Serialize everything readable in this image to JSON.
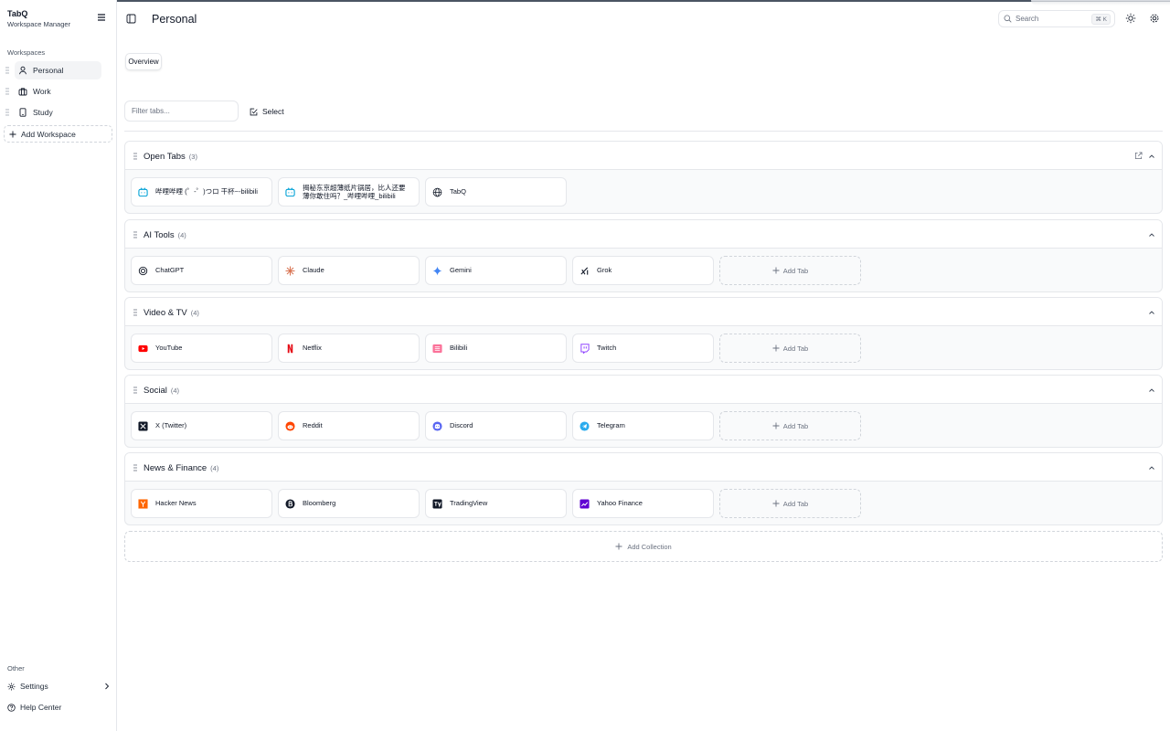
{
  "app": {
    "title": "TabQ",
    "subtitle": "Workspace Manager"
  },
  "sidebar": {
    "workspaces_label": "Workspaces",
    "workspaces": [
      {
        "label": "Personal",
        "icon": "user-icon",
        "active": true
      },
      {
        "label": "Work",
        "icon": "briefcase-icon",
        "active": false
      },
      {
        "label": "Study",
        "icon": "tablet-icon",
        "active": false
      }
    ],
    "add_workspace_label": "Add Workspace",
    "other_label": "Other",
    "settings_label": "Settings",
    "help_label": "Help Center"
  },
  "header": {
    "title": "Personal",
    "search_placeholder": "Search",
    "search_shortcut": "⌘ K"
  },
  "view_tabs": [
    {
      "label": "Overview",
      "active": true
    }
  ],
  "toolbar": {
    "filter_placeholder": "Filter tabs...",
    "select_label": "Select"
  },
  "collections": [
    {
      "name": "Open Tabs",
      "count": "(3)",
      "tabs": [
        {
          "title": "哔哩哔哩 (゜-゜)つロ 干杯~-bilibili",
          "icon": "bilibili-tv-icon"
        },
        {
          "title": "揭秘东京超薄纸片锅居，比人还要薄你敢住吗？_哔哩哔哩_bilibili",
          "icon": "bilibili-tv-icon"
        },
        {
          "title": "TabQ",
          "icon": "globe-icon"
        }
      ],
      "add_tab": false
    },
    {
      "name": "AI Tools",
      "count": "(4)",
      "tabs": [
        {
          "title": "ChatGPT",
          "icon": "chatgpt-icon"
        },
        {
          "title": "Claude",
          "icon": "claude-icon"
        },
        {
          "title": "Gemini",
          "icon": "gemini-icon"
        },
        {
          "title": "Grok",
          "icon": "grok-icon"
        }
      ],
      "add_tab": true
    },
    {
      "name": "Video & TV",
      "count": "(4)",
      "tabs": [
        {
          "title": "YouTube",
          "icon": "youtube-icon"
        },
        {
          "title": "Netflix",
          "icon": "netflix-icon"
        },
        {
          "title": "Bilibili",
          "icon": "bilibili-icon"
        },
        {
          "title": "Twitch",
          "icon": "twitch-icon"
        }
      ],
      "add_tab": true
    },
    {
      "name": "Social",
      "count": "(4)",
      "tabs": [
        {
          "title": "X (Twitter)",
          "icon": "x-icon"
        },
        {
          "title": "Reddit",
          "icon": "reddit-icon"
        },
        {
          "title": "Discord",
          "icon": "discord-icon"
        },
        {
          "title": "Telegram",
          "icon": "telegram-icon"
        }
      ],
      "add_tab": true
    },
    {
      "name": "News & Finance",
      "count": "(4)",
      "tabs": [
        {
          "title": "Hacker News",
          "icon": "hacker-news-icon"
        },
        {
          "title": "Bloomberg",
          "icon": "bloomberg-icon"
        },
        {
          "title": "TradingView",
          "icon": "tradingview-icon"
        },
        {
          "title": "Yahoo Finance",
          "icon": "yahoo-finance-icon"
        }
      ],
      "add_tab": true
    }
  ],
  "add_tab_label": "Add Tab",
  "add_collection_label": "Add Collection",
  "colors": {
    "border": "#e5e7eb",
    "youtube": "#ff0000",
    "netflix": "#e50914",
    "bilibili": "#00a1d6",
    "twitch": "#9146ff",
    "reddit": "#ff4500",
    "discord": "#5865f2",
    "telegram": "#2aabee",
    "hacker_news": "#ff6600",
    "yahoo": "#6001d2",
    "claude": "#d97757"
  }
}
